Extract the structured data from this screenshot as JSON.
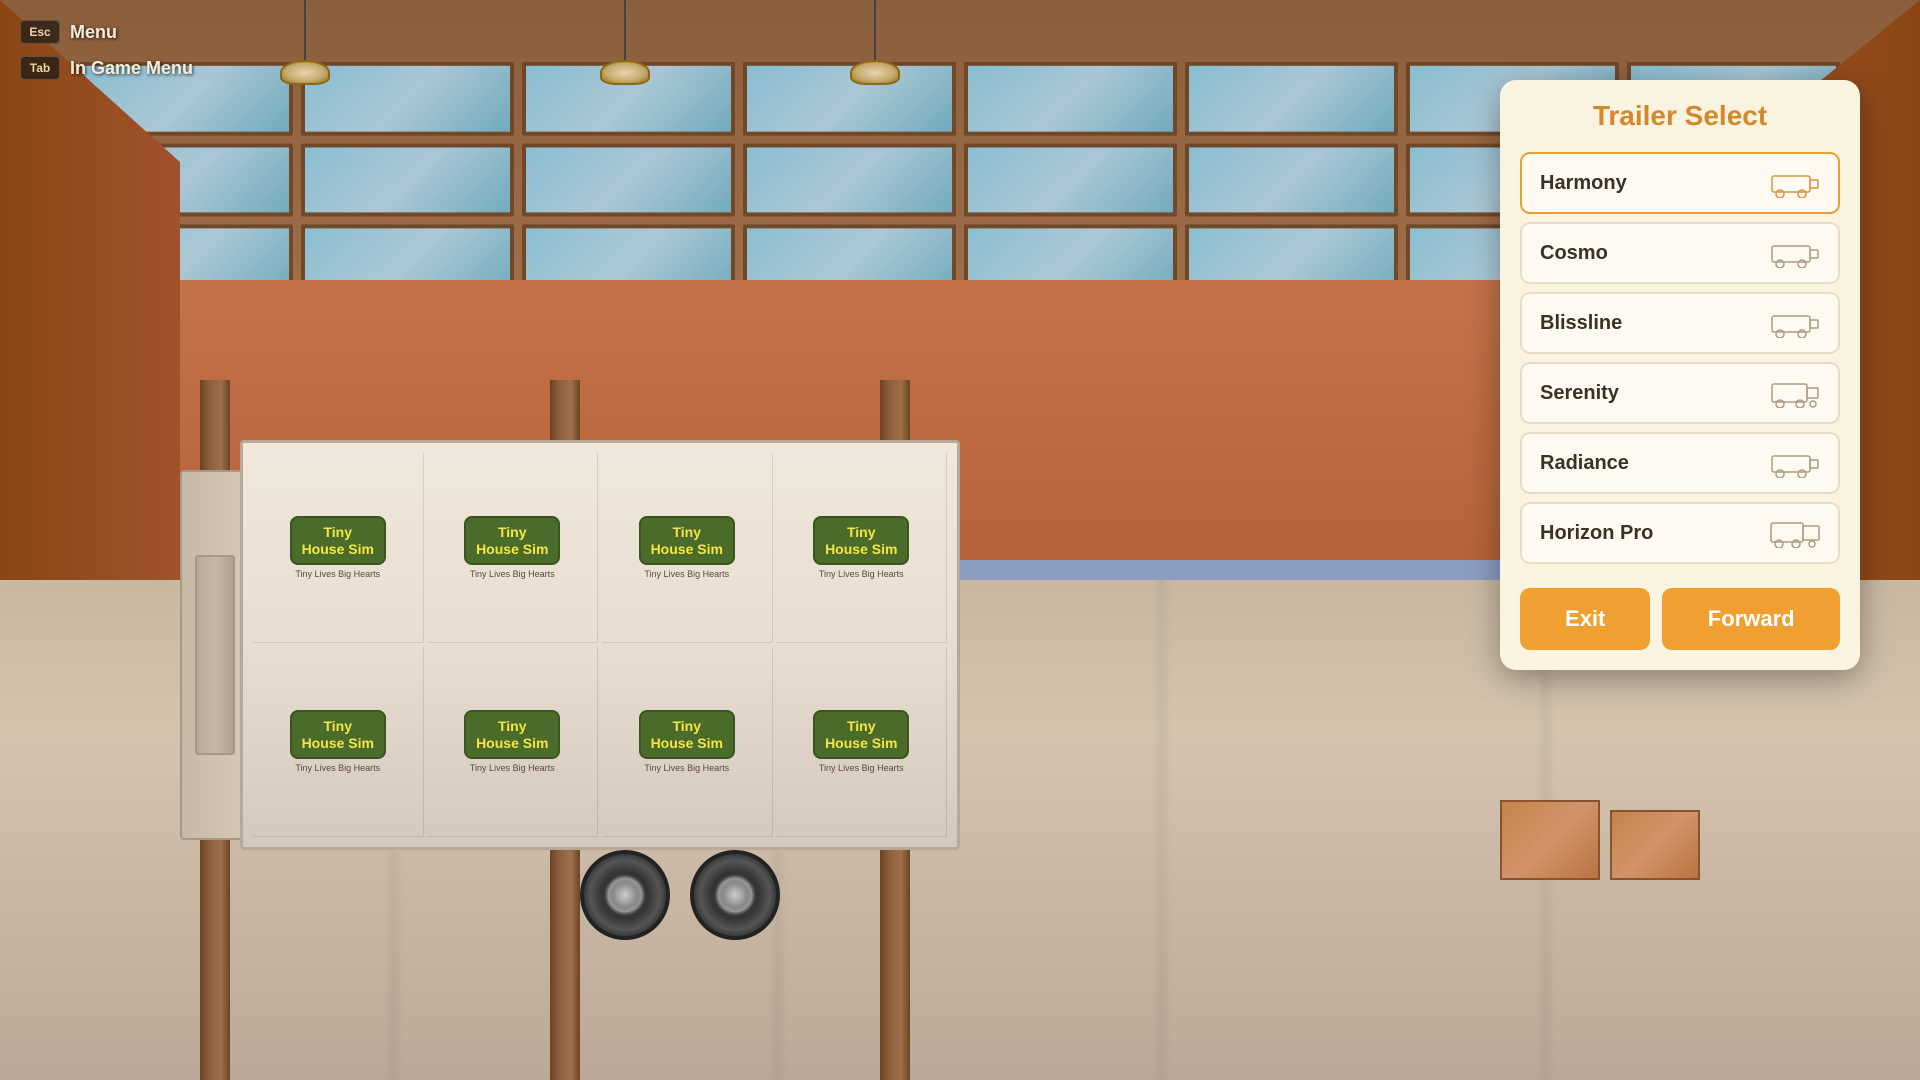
{
  "shortcuts": {
    "esc_key": "Esc",
    "esc_label": "Menu",
    "tab_key": "Tab",
    "tab_label": "In Game Menu"
  },
  "panel": {
    "title": "Trailer Select"
  },
  "trailers": [
    {
      "id": "harmony",
      "name": "Harmony",
      "selected": true
    },
    {
      "id": "cosmo",
      "name": "Cosmo",
      "selected": false
    },
    {
      "id": "blissline",
      "name": "Blissline",
      "selected": false
    },
    {
      "id": "serenity",
      "name": "Serenity",
      "selected": false
    },
    {
      "id": "radiance",
      "name": "Radiance",
      "selected": false
    },
    {
      "id": "horizon-pro",
      "name": "Horizon Pro",
      "selected": false
    }
  ],
  "buttons": {
    "exit": "Exit",
    "forward": "Forward"
  },
  "branding": {
    "logo_line1": "Tiny",
    "logo_line2": "House Sim",
    "tagline": "Tiny Lives Big Hearts"
  }
}
